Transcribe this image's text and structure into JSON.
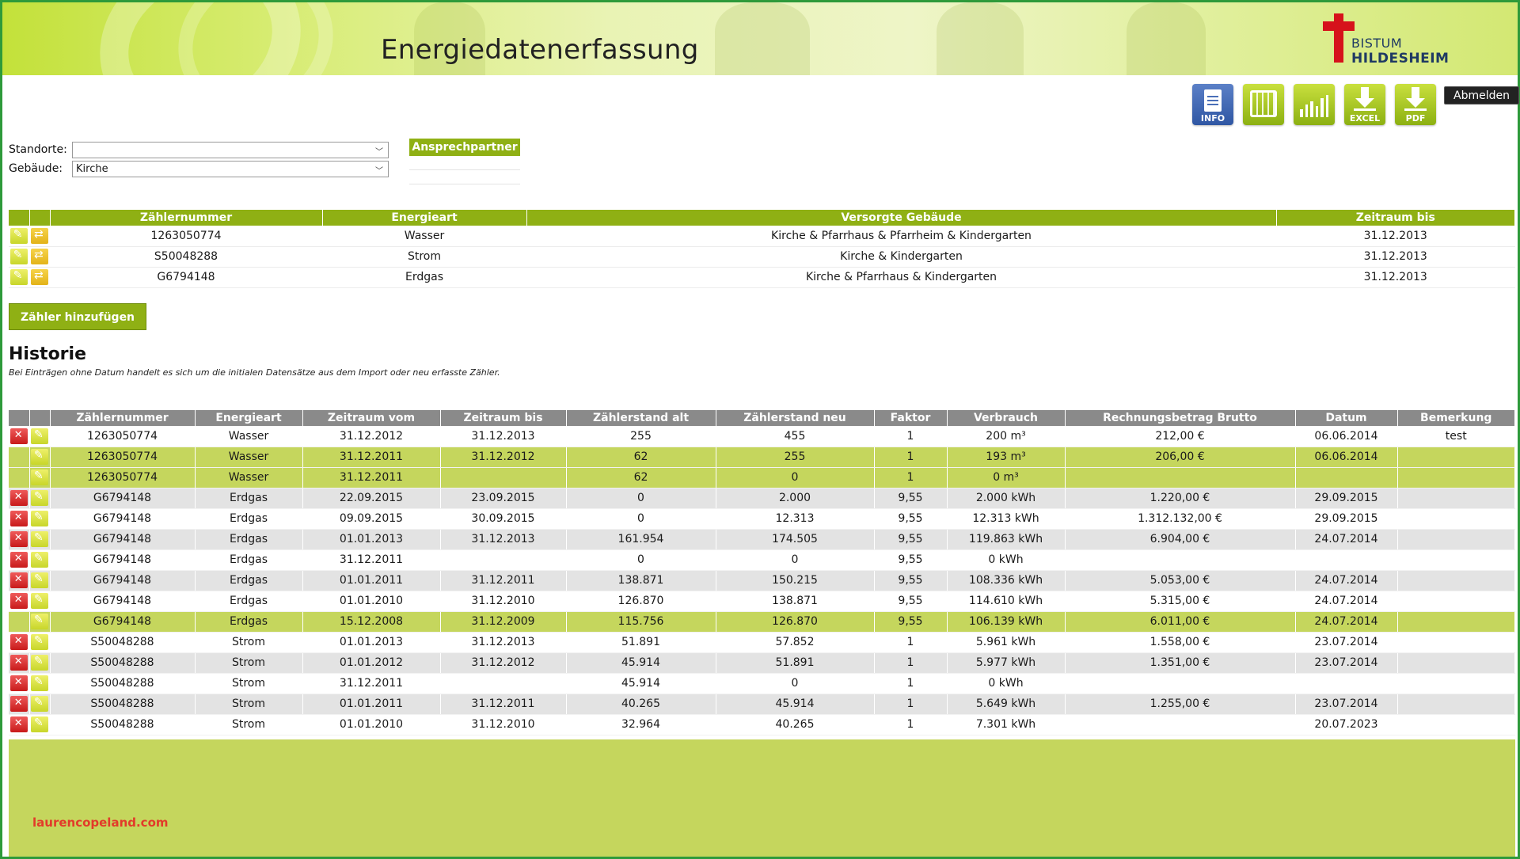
{
  "app": {
    "title": "Energiedatenerfassung",
    "logo_line1": "BISTUM",
    "logo_line2": "HILDESHEIM",
    "logout_label": "Abmelden"
  },
  "toolbar": {
    "items": [
      {
        "icon": "info-document-icon",
        "label": "INFO"
      },
      {
        "icon": "calendar-icon",
        "label": ""
      },
      {
        "icon": "bar-chart-icon",
        "label": ""
      },
      {
        "icon": "download-excel-icon",
        "label": "EXCEL"
      },
      {
        "icon": "download-pdf-icon",
        "label": "PDF"
      }
    ]
  },
  "filters": {
    "standorte_label": "Standorte:",
    "standorte_value": "",
    "gebaeude_label": "Gebäude:",
    "gebaeude_value": "Kirche"
  },
  "contact": {
    "label": "Ansprechpartner"
  },
  "meters": {
    "headers": [
      "Zählernummer",
      "Energieart",
      "Versorgte Gebäude",
      "Zeitraum bis"
    ],
    "rows": [
      {
        "number": "1263050774",
        "type": "Wasser",
        "buildings": "Kirche & Pfarrhaus & Pfarrheim & Kindergarten",
        "until": "31.12.2013"
      },
      {
        "number": "S50048288",
        "type": "Strom",
        "buildings": "Kirche & Kindergarten",
        "until": "31.12.2013"
      },
      {
        "number": "G6794148",
        "type": "Erdgas",
        "buildings": "Kirche & Pfarrhaus & Kindergarten",
        "until": "31.12.2013"
      }
    ],
    "add_label": "Zähler hinzufügen"
  },
  "history": {
    "title": "Historie",
    "note": "Bei Einträgen ohne Datum handelt es sich um die initialen Datensätze aus dem Import oder neu erfasste Zähler.",
    "headers": [
      "Zählernummer",
      "Energieart",
      "Zeitraum vom",
      "Zeitraum bis",
      "Zählerstand alt",
      "Zählerstand neu",
      "Faktor",
      "Verbrauch",
      "Rechnungsbetrag Brutto",
      "Datum",
      "Bemerkung"
    ],
    "rows": [
      {
        "del": true,
        "hl": false,
        "c": [
          "1263050774",
          "Wasser",
          "31.12.2012",
          "31.12.2013",
          "255",
          "455",
          "1",
          "200 m³",
          "212,00 €",
          "06.06.2014",
          "test"
        ]
      },
      {
        "del": false,
        "hl": true,
        "c": [
          "1263050774",
          "Wasser",
          "31.12.2011",
          "31.12.2012",
          "62",
          "255",
          "1",
          "193 m³",
          "206,00 €",
          "06.06.2014",
          ""
        ]
      },
      {
        "del": false,
        "hl": true,
        "c": [
          "1263050774",
          "Wasser",
          "31.12.2011",
          "",
          "62",
          "0",
          "1",
          "0 m³",
          "",
          "",
          ""
        ]
      },
      {
        "del": true,
        "hl": false,
        "c": [
          "G6794148",
          "Erdgas",
          "22.09.2015",
          "23.09.2015",
          "0",
          "2.000",
          "9,55",
          "2.000 kWh",
          "1.220,00 €",
          "29.09.2015",
          ""
        ]
      },
      {
        "del": true,
        "hl": false,
        "c": [
          "G6794148",
          "Erdgas",
          "09.09.2015",
          "30.09.2015",
          "0",
          "12.313",
          "9,55",
          "12.313 kWh",
          "1.312.132,00 €",
          "29.09.2015",
          ""
        ]
      },
      {
        "del": true,
        "hl": false,
        "c": [
          "G6794148",
          "Erdgas",
          "01.01.2013",
          "31.12.2013",
          "161.954",
          "174.505",
          "9,55",
          "119.863 kWh",
          "6.904,00 €",
          "24.07.2014",
          ""
        ]
      },
      {
        "del": true,
        "hl": false,
        "c": [
          "G6794148",
          "Erdgas",
          "31.12.2011",
          "",
          "0",
          "0",
          "9,55",
          "0 kWh",
          "",
          "",
          ""
        ]
      },
      {
        "del": true,
        "hl": false,
        "c": [
          "G6794148",
          "Erdgas",
          "01.01.2011",
          "31.12.2011",
          "138.871",
          "150.215",
          "9,55",
          "108.336 kWh",
          "5.053,00 €",
          "24.07.2014",
          ""
        ]
      },
      {
        "del": true,
        "hl": false,
        "c": [
          "G6794148",
          "Erdgas",
          "01.01.2010",
          "31.12.2010",
          "126.870",
          "138.871",
          "9,55",
          "114.610 kWh",
          "5.315,00 €",
          "24.07.2014",
          ""
        ]
      },
      {
        "del": false,
        "hl": true,
        "c": [
          "G6794148",
          "Erdgas",
          "15.12.2008",
          "31.12.2009",
          "115.756",
          "126.870",
          "9,55",
          "106.139 kWh",
          "6.011,00 €",
          "24.07.2014",
          ""
        ]
      },
      {
        "del": true,
        "hl": false,
        "c": [
          "S50048288",
          "Strom",
          "01.01.2013",
          "31.12.2013",
          "51.891",
          "57.852",
          "1",
          "5.961 kWh",
          "1.558,00 €",
          "23.07.2014",
          ""
        ]
      },
      {
        "del": true,
        "hl": false,
        "c": [
          "S50048288",
          "Strom",
          "01.01.2012",
          "31.12.2012",
          "45.914",
          "51.891",
          "1",
          "5.977 kWh",
          "1.351,00 €",
          "23.07.2014",
          ""
        ]
      },
      {
        "del": true,
        "hl": false,
        "c": [
          "S50048288",
          "Strom",
          "31.12.2011",
          "",
          "45.914",
          "0",
          "1",
          "0 kWh",
          "",
          "",
          ""
        ]
      },
      {
        "del": true,
        "hl": false,
        "c": [
          "S50048288",
          "Strom",
          "01.01.2011",
          "31.12.2011",
          "40.265",
          "45.914",
          "1",
          "5.649 kWh",
          "1.255,00 €",
          "23.07.2014",
          ""
        ]
      },
      {
        "del": true,
        "hl": false,
        "c": [
          "S50048288",
          "Strom",
          "01.01.2010",
          "31.12.2010",
          "32.964",
          "40.265",
          "1",
          "7.301 kWh",
          "",
          "20.07.2023",
          ""
        ]
      }
    ]
  },
  "watermark": "laurencopeland.com",
  "colors": {
    "accent": "#8fb014",
    "header_bg": "#d7ec72",
    "history_header": "#8a8a8a",
    "highlight_row": "#c5d65d",
    "delete": "#c81a1a",
    "info_blue": "#2f56a3"
  }
}
